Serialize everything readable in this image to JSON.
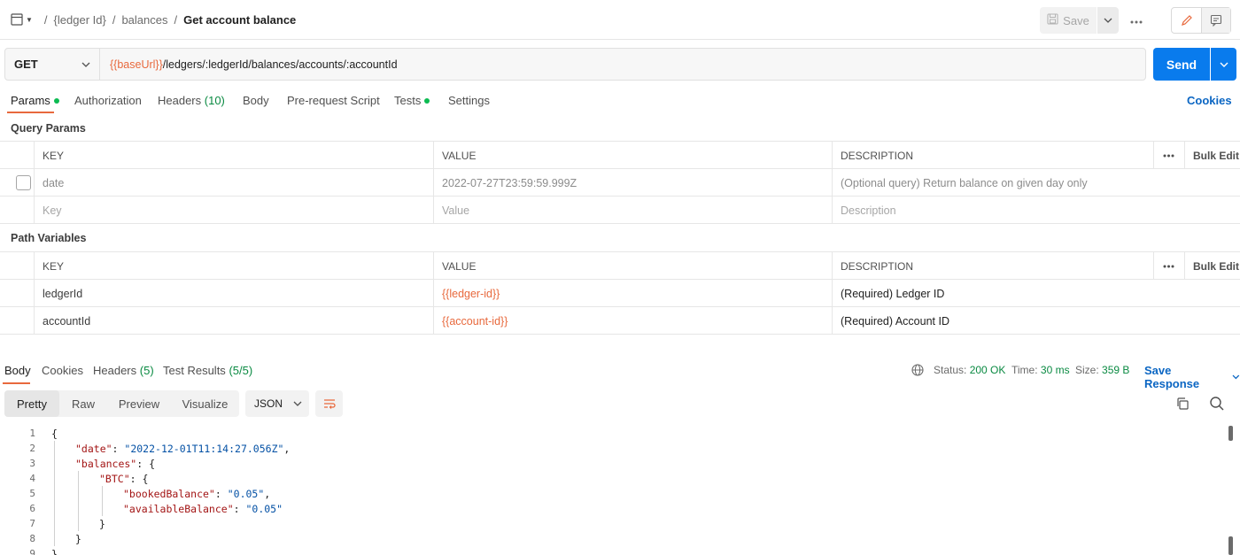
{
  "breadcrumb": {
    "items": [
      "{ledger Id}",
      "balances"
    ],
    "separator": "/",
    "current": "Get account balance"
  },
  "toolbar": {
    "save_label": "Save"
  },
  "request": {
    "method": "GET",
    "url_var": "{{baseUrl}}",
    "url_path": "/ledgers/:ledgerId/balances/accounts/:accountId",
    "send_label": "Send"
  },
  "request_tabs": {
    "params": "Params",
    "authorization": "Authorization",
    "headers": "Headers",
    "headers_count": "(10)",
    "body": "Body",
    "prerequest": "Pre-request Script",
    "tests": "Tests",
    "settings": "Settings",
    "cookies": "Cookies"
  },
  "query_params": {
    "title": "Query Params",
    "columns": {
      "key": "KEY",
      "value": "VALUE",
      "description": "DESCRIPTION"
    },
    "bulk_edit": "Bulk Edit",
    "rows": [
      {
        "key": "date",
        "value": "2022-07-27T23:59:59.999Z",
        "description": "(Optional query) Return balance on given day only",
        "checked": false
      }
    ],
    "placeholder": {
      "key": "Key",
      "value": "Value",
      "description": "Description"
    }
  },
  "path_variables": {
    "title": "Path Variables",
    "columns": {
      "key": "KEY",
      "value": "VALUE",
      "description": "DESCRIPTION"
    },
    "bulk_edit": "Bulk Edit",
    "rows": [
      {
        "key": "ledgerId",
        "value": "{{ledger-id}}",
        "description": "(Required) Ledger ID"
      },
      {
        "key": "accountId",
        "value": "{{account-id}}",
        "description": "(Required) Account ID"
      }
    ]
  },
  "response": {
    "tabs": {
      "body": "Body",
      "cookies": "Cookies",
      "headers": "Headers",
      "headers_count": "(5)",
      "tests": "Test Results",
      "tests_count": "(5/5)"
    },
    "status_label": "Status:",
    "status_value": "200 OK",
    "time_label": "Time:",
    "time_value": "30 ms",
    "size_label": "Size:",
    "size_value": "359 B",
    "save_response": "Save Response",
    "views": [
      "Pretty",
      "Raw",
      "Preview",
      "Visualize"
    ],
    "format": "JSON",
    "code_lines": [
      {
        "n": "1",
        "indent": 0,
        "parts": [
          [
            "p",
            "{"
          ]
        ]
      },
      {
        "n": "2",
        "indent": 1,
        "parts": [
          [
            "k",
            "\"date\""
          ],
          [
            "p",
            ": "
          ],
          [
            "s",
            "\"2022-12-01T11:14:27.056Z\""
          ],
          [
            "p",
            ","
          ]
        ]
      },
      {
        "n": "3",
        "indent": 1,
        "parts": [
          [
            "k",
            "\"balances\""
          ],
          [
            "p",
            ": {"
          ]
        ]
      },
      {
        "n": "4",
        "indent": 2,
        "parts": [
          [
            "k",
            "\"BTC\""
          ],
          [
            "p",
            ": {"
          ]
        ]
      },
      {
        "n": "5",
        "indent": 3,
        "parts": [
          [
            "k",
            "\"bookedBalance\""
          ],
          [
            "p",
            ": "
          ],
          [
            "s",
            "\"0.05\""
          ],
          [
            "p",
            ","
          ]
        ]
      },
      {
        "n": "6",
        "indent": 3,
        "parts": [
          [
            "k",
            "\"availableBalance\""
          ],
          [
            "p",
            ": "
          ],
          [
            "s",
            "\"0.05\""
          ]
        ]
      },
      {
        "n": "7",
        "indent": 2,
        "parts": [
          [
            "p",
            "}"
          ]
        ]
      },
      {
        "n": "8",
        "indent": 1,
        "parts": [
          [
            "p",
            "}"
          ]
        ]
      },
      {
        "n": "9",
        "indent": 0,
        "parts": [
          [
            "p",
            "}"
          ]
        ]
      }
    ]
  },
  "colors": {
    "accent": "#e8693d",
    "primary": "#097bed",
    "link": "#0b66c3",
    "success": "#0cbb52"
  }
}
